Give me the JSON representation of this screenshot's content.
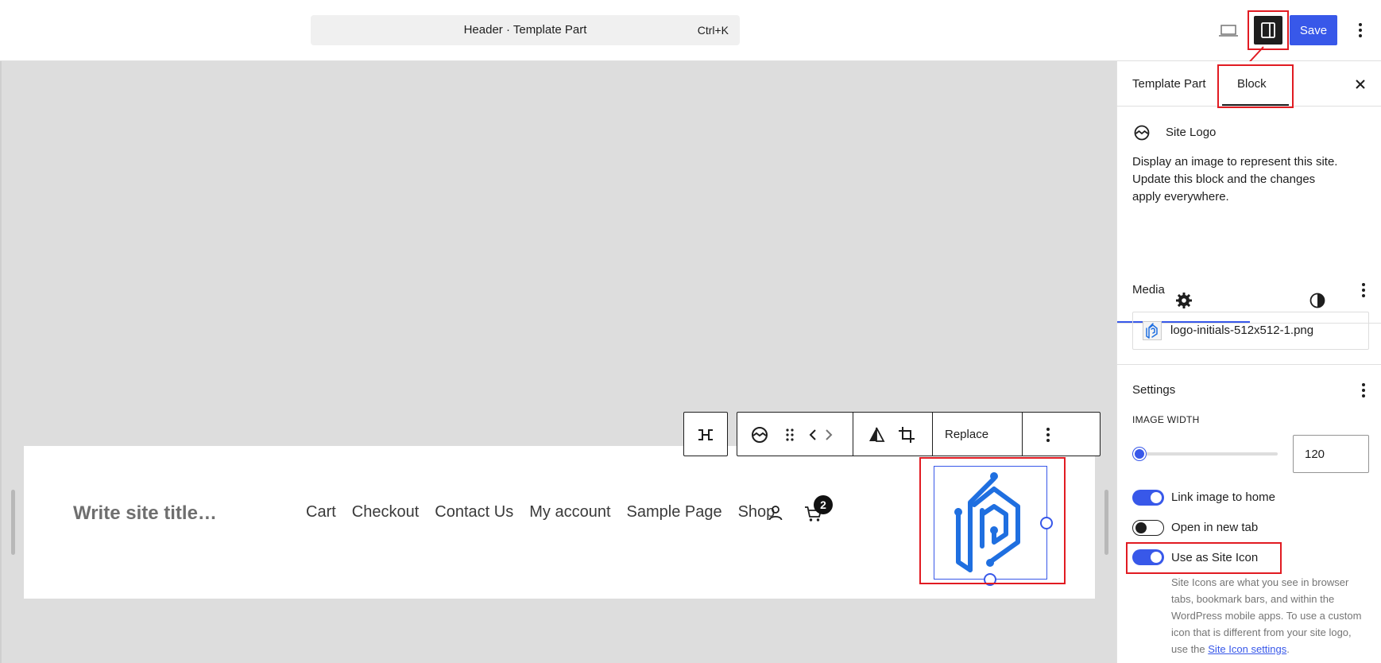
{
  "topbar": {
    "command_title": "Header · Template Part",
    "command_shortcut": "Ctrl+K",
    "save_label": "Save"
  },
  "canvas": {
    "site_title_placeholder": "Write site title…",
    "nav_items": [
      "Cart",
      "Checkout",
      "Contact Us",
      "My account",
      "Sample Page",
      "Shop"
    ],
    "cart_count": "2",
    "toolbar": {
      "replace_label": "Replace"
    }
  },
  "sidebar": {
    "tabs": [
      "Template Part",
      "Block"
    ],
    "active_tab": "Block",
    "block": {
      "title": "Site Logo",
      "description": "Display an image to represent this site. Update this block and the changes apply everywhere."
    },
    "media": {
      "title": "Media",
      "file_name": "logo-initials-512x512-1.png"
    },
    "settings": {
      "title": "Settings",
      "image_width_label": "IMAGE WIDTH",
      "image_width_value": "120",
      "image_width_fraction": 0.05,
      "toggles": [
        {
          "label": "Link image to home",
          "on": true
        },
        {
          "label": "Open in new tab",
          "on": false
        },
        {
          "label": "Use as Site Icon",
          "on": true
        }
      ],
      "help_text_before": "Site Icons are what you see in browser tabs, bookmark bars, and within the WordPress mobile apps. To use a custom icon that is different from your site logo, use the ",
      "help_link": "Site Icon settings",
      "help_text_after": "."
    }
  },
  "colors": {
    "accent": "#3858e9",
    "annotation": "#e11b22",
    "logo_blue": "#1f6fe0",
    "canvas_bg": "#dddddd"
  }
}
